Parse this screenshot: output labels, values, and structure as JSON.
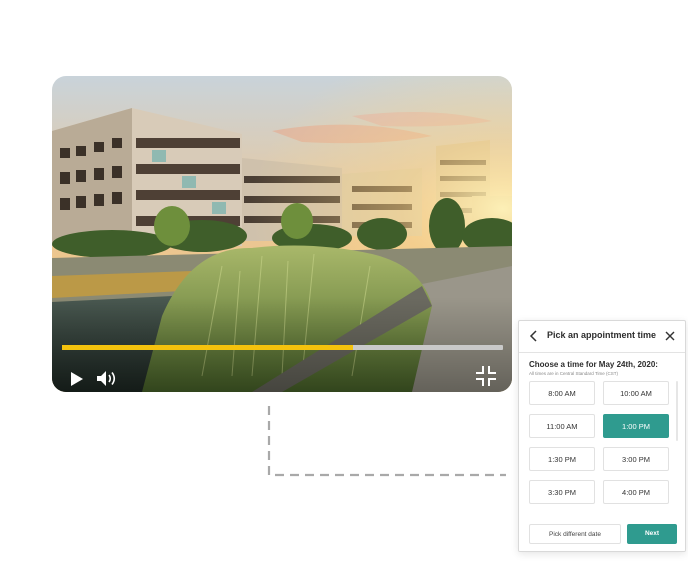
{
  "video": {
    "progress": 0.66,
    "colors": {
      "progress_fill": "#f4c20d",
      "progress_track": "#c9c9c9"
    },
    "icons": {
      "play": "play-icon",
      "volume": "volume-icon",
      "fullscreen": "exit-fullscreen-icon"
    }
  },
  "appointment": {
    "title": "Pick an appointment time",
    "date_heading": "Choose a time for May 24th, 2020:",
    "timezone_note": "All times are in Central Standard Time (CST)",
    "slots": [
      {
        "label": "8:00 AM",
        "selected": false
      },
      {
        "label": "10:00 AM",
        "selected": false
      },
      {
        "label": "11:00 AM",
        "selected": false
      },
      {
        "label": "1:00 PM",
        "selected": true
      },
      {
        "label": "1:30 PM",
        "selected": false
      },
      {
        "label": "3:00 PM",
        "selected": false
      },
      {
        "label": "3:30 PM",
        "selected": false
      },
      {
        "label": "4:00 PM",
        "selected": false
      }
    ],
    "pick_different_date_label": "Pick different date",
    "next_label": "Next",
    "accent_color": "#2f9b8f",
    "icons": {
      "back": "chevron-left-icon",
      "close": "close-icon"
    }
  }
}
